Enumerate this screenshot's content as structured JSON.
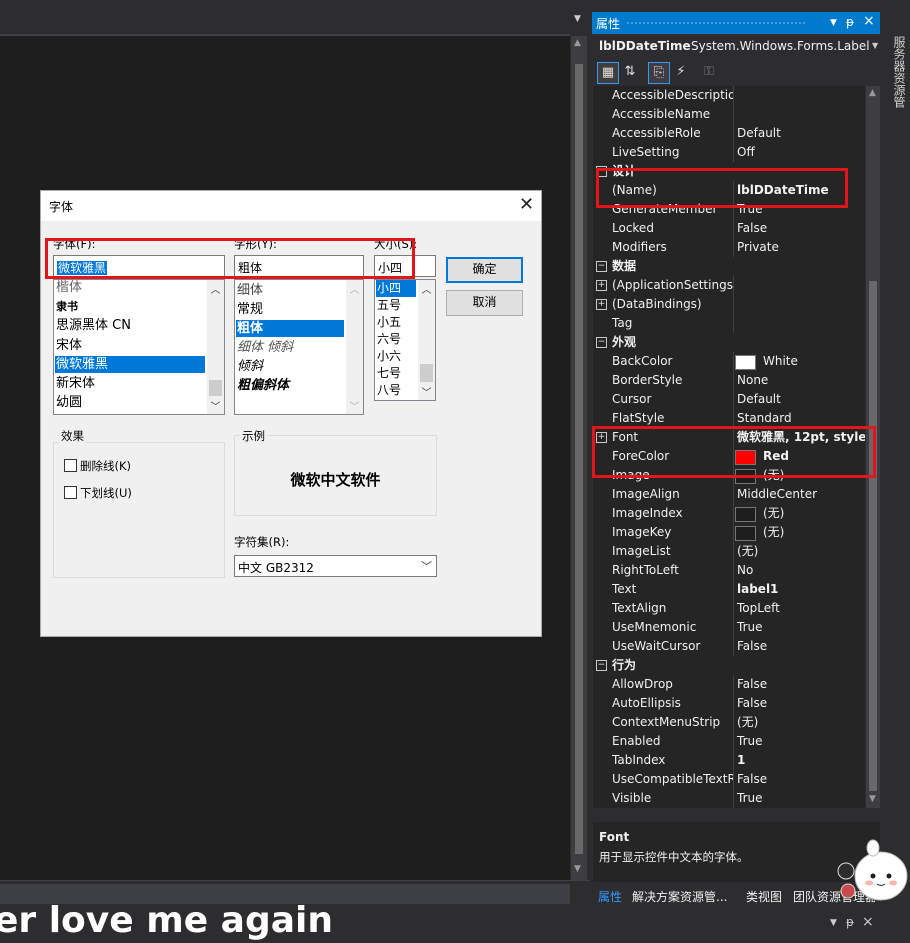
{
  "editor": {
    "lyric": "er love me again"
  },
  "font_dialog": {
    "title": "字体",
    "font_label": "字体(F):",
    "font_value": "微软雅黑",
    "font_list": [
      "楷体",
      "隶书",
      "思源黑体 CN",
      "宋体",
      "微软雅黑",
      "新宋体",
      "幼圆"
    ],
    "font_selected": "微软雅黑",
    "style_label": "字形(Y):",
    "style_value": "粗体",
    "style_list": [
      "细体",
      "常规",
      "粗体",
      "细体 倾斜",
      "倾斜",
      "粗偏斜体"
    ],
    "style_selected": "粗体",
    "size_label": "大小(S):",
    "size_value": "小四",
    "size_list": [
      "小四",
      "五号",
      "小五",
      "六号",
      "小六",
      "七号",
      "八号"
    ],
    "size_selected": "小四",
    "ok_label": "确定",
    "cancel_label": "取消",
    "effects_label": "效果",
    "strikeout_label": "删除线(K)",
    "underline_label": "下划线(U)",
    "sample_label": "示例",
    "sample_text": "微软中文软件",
    "charset_label": "字符集(R):",
    "charset_value": "中文 GB2312"
  },
  "properties_panel": {
    "title": "属性",
    "object_name": "lblDDateTime",
    "object_type": "System.Windows.Forms.Label",
    "side_tab": "服务器资源管理器",
    "rows": [
      {
        "name": "AccessibleDescriptio",
        "value": ""
      },
      {
        "name": "AccessibleName",
        "value": ""
      },
      {
        "name": "AccessibleRole",
        "value": "Default"
      },
      {
        "name": "LiveSetting",
        "value": "Off"
      },
      {
        "category": "设计"
      },
      {
        "name": "(Name)",
        "value": "lblDDateTime",
        "bold": true
      },
      {
        "name": "GenerateMember",
        "value": "True"
      },
      {
        "name": "Locked",
        "value": "False"
      },
      {
        "name": "Modifiers",
        "value": "Private"
      },
      {
        "category": "数据"
      },
      {
        "name": "(ApplicationSettings)",
        "value": "",
        "expander": "+"
      },
      {
        "name": "(DataBindings)",
        "value": "",
        "expander": "+"
      },
      {
        "name": "Tag",
        "value": ""
      },
      {
        "category": "外观"
      },
      {
        "name": "BackColor",
        "value": "White",
        "swatch": "#ffffff"
      },
      {
        "name": "BorderStyle",
        "value": "None"
      },
      {
        "name": "Cursor",
        "value": "Default"
      },
      {
        "name": "FlatStyle",
        "value": "Standard"
      },
      {
        "name": "Font",
        "value": "微软雅黑, 12pt, style=",
        "bold": true,
        "expander": "+"
      },
      {
        "name": "ForeColor",
        "value": "Red",
        "bold": true,
        "swatch": "#ff0000"
      },
      {
        "name": "Image",
        "value": "(无)",
        "swatch": "#1e1e1e"
      },
      {
        "name": "ImageAlign",
        "value": "MiddleCenter"
      },
      {
        "name": "ImageIndex",
        "value": "(无)",
        "swatch": "#1e1e1e"
      },
      {
        "name": "ImageKey",
        "value": "(无)",
        "swatch": "#1e1e1e"
      },
      {
        "name": "ImageList",
        "value": "(无)"
      },
      {
        "name": "RightToLeft",
        "value": "No"
      },
      {
        "name": "Text",
        "value": "label1",
        "bold": true
      },
      {
        "name": "TextAlign",
        "value": "TopLeft"
      },
      {
        "name": "UseMnemonic",
        "value": "True"
      },
      {
        "name": "UseWaitCursor",
        "value": "False"
      },
      {
        "category": "行为"
      },
      {
        "name": "AllowDrop",
        "value": "False"
      },
      {
        "name": "AutoEllipsis",
        "value": "False"
      },
      {
        "name": "ContextMenuStrip",
        "value": "(无)"
      },
      {
        "name": "Enabled",
        "value": "True"
      },
      {
        "name": "TabIndex",
        "value": "1",
        "bold": true
      },
      {
        "name": "UseCompatibleTextR",
        "value": "False"
      },
      {
        "name": "Visible",
        "value": "True"
      }
    ],
    "description_title": "Font",
    "description_text": "用于显示控件中文本的字体。",
    "bottom_tabs": [
      "属性",
      "解决方案资源管...",
      "类视图",
      "团队资源管理器"
    ],
    "active_tab": "属性"
  },
  "colors": {
    "accent": "#007acc",
    "highlight": "#e0161a",
    "selection": "#0078d7"
  }
}
